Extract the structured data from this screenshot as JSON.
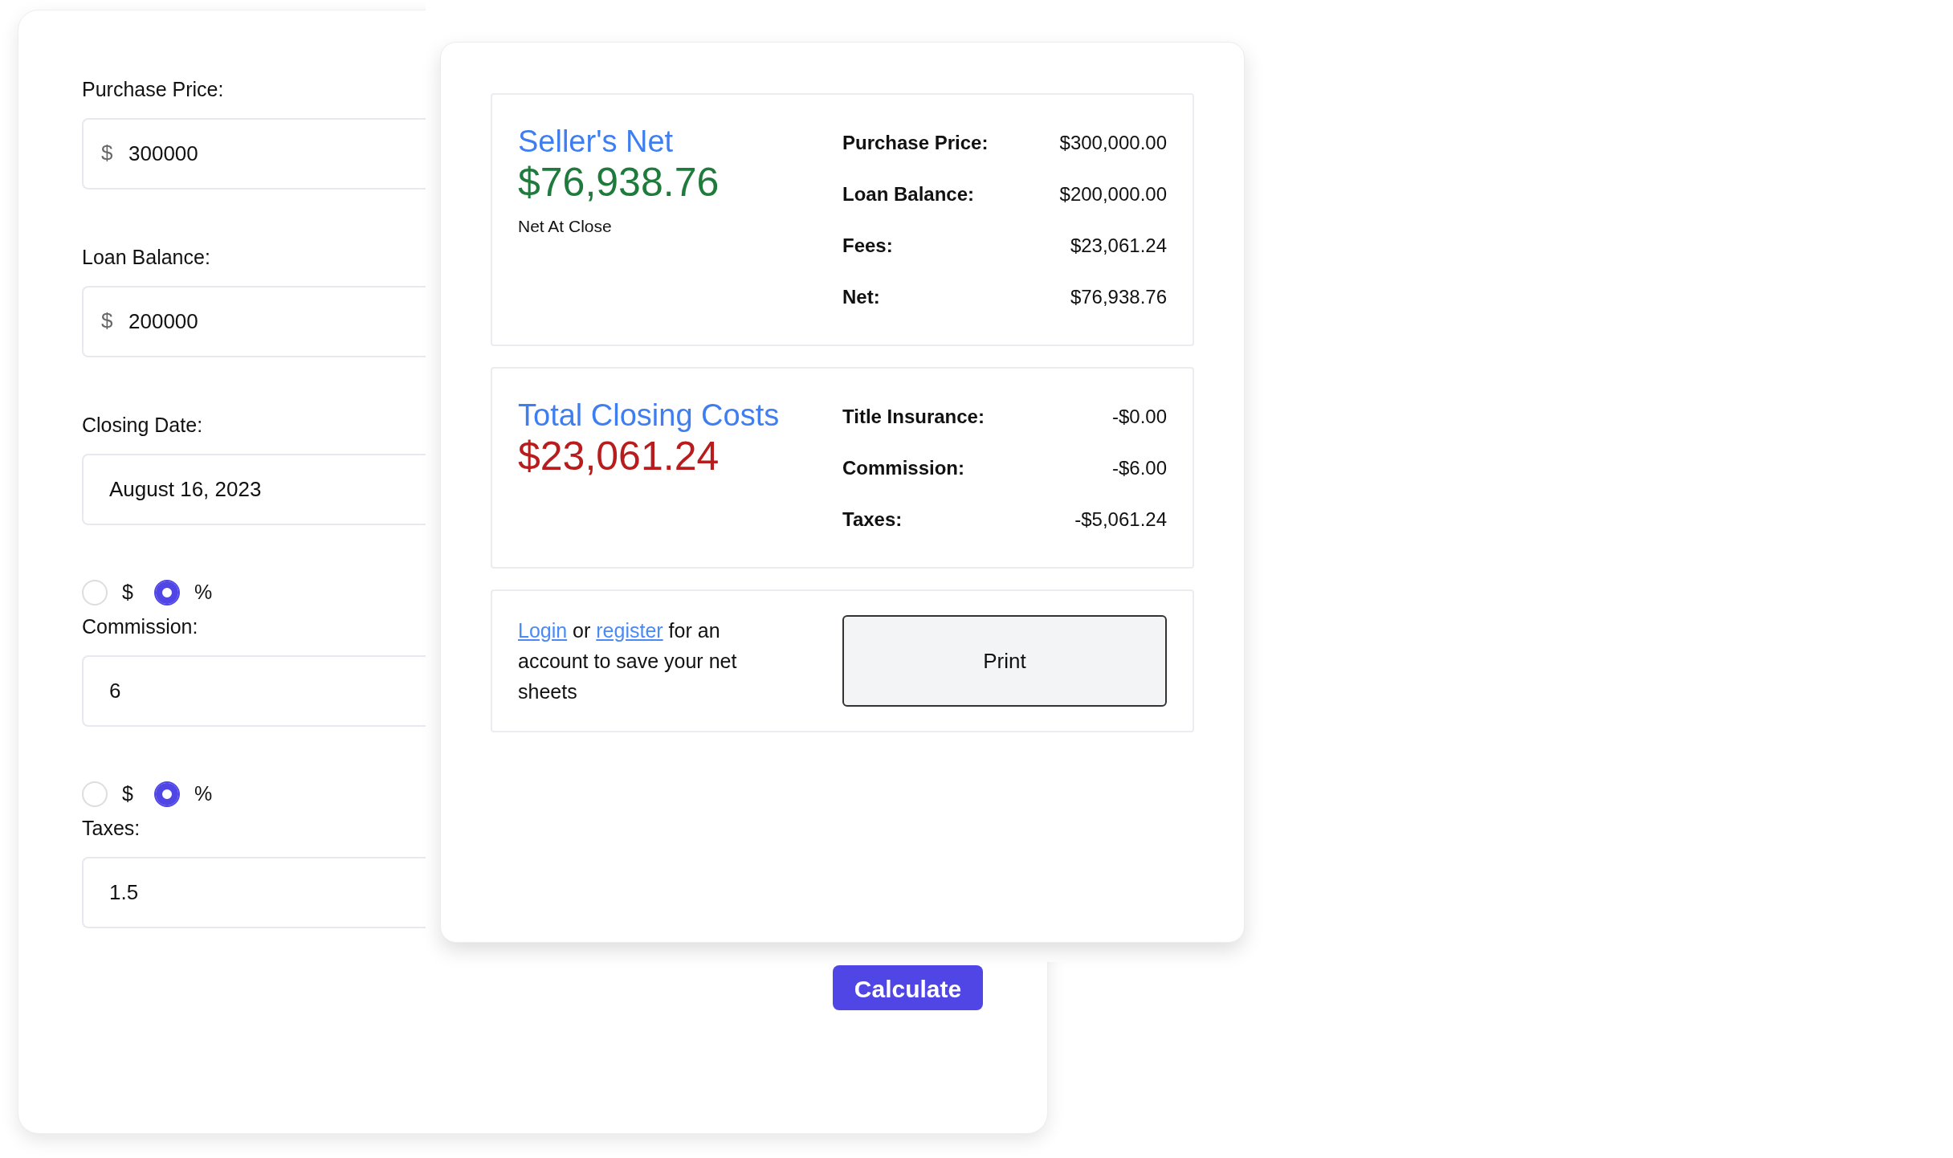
{
  "form": {
    "fields": [
      {
        "kind": "currency",
        "label": "Purchase Price:",
        "prefix": "$",
        "value": "300000"
      },
      {
        "kind": "currency",
        "label": "Loan Balance:",
        "prefix": "$",
        "value": "200000"
      },
      {
        "kind": "plain",
        "label": "Closing Date:",
        "value": "August 16, 2023"
      },
      {
        "kind": "unit",
        "label": "Commission:",
        "value": "6",
        "units": [
          {
            "label": "$",
            "selected": false
          },
          {
            "label": "%",
            "selected": true
          }
        ]
      },
      {
        "kind": "unit",
        "label": "Taxes:",
        "value": "1.5",
        "units": [
          {
            "label": "$",
            "selected": false
          },
          {
            "label": "%",
            "selected": true
          }
        ]
      }
    ],
    "calculate_button": "Calculate"
  },
  "results": {
    "summary_cards": [
      {
        "title": "Seller's Net",
        "amount": "$76,938.76",
        "color": "#1e7b3c",
        "caption": "Net At Close",
        "rows": [
          {
            "label": "Purchase Price:",
            "value": "$300,000.00"
          },
          {
            "label": "Loan Balance:",
            "value": "$200,000.00"
          },
          {
            "label": "Fees:",
            "value": "$23,061.24"
          },
          {
            "label": "Net:",
            "value": "$76,938.76"
          }
        ]
      },
      {
        "title": "Total Closing Costs",
        "amount": "$23,061.24",
        "color": "#b81c1c",
        "rows": [
          {
            "label": "Title Insurance:",
            "value": "-$0.00"
          },
          {
            "label": "Commission:",
            "value": "-$6.00"
          },
          {
            "label": "Taxes:",
            "value": "-$5,061.24"
          }
        ]
      }
    ],
    "account_prompt": [
      {
        "kind": "link",
        "text": "Login"
      },
      {
        "kind": "text",
        "text": " or "
      },
      {
        "kind": "link",
        "text": "register"
      },
      {
        "kind": "text",
        "text": " for an account to save your net sheets"
      }
    ],
    "print_button": "Print"
  }
}
